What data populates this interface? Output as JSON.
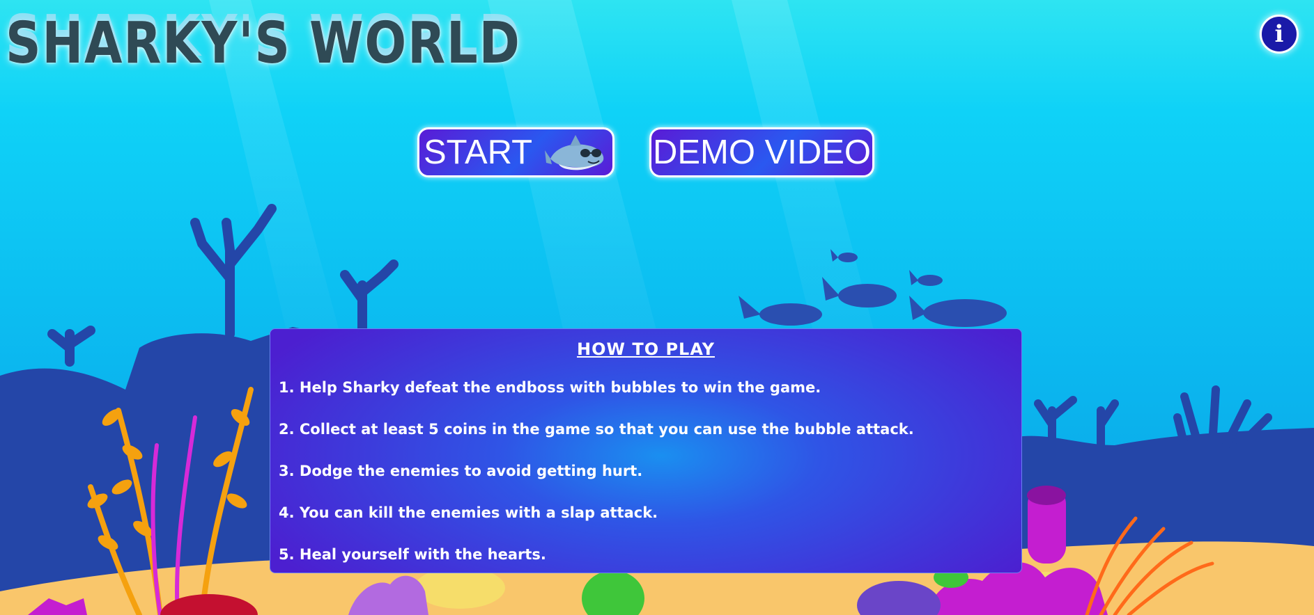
{
  "game_title": "SHARKY'S WORLD",
  "info_button": {
    "label": "i",
    "icon": "info-icon"
  },
  "menu": {
    "start_label": "START",
    "start_icon": "shark-icon",
    "demo_label": "DEMO VIDEO"
  },
  "how_to_play": {
    "title": "HOW TO PLAY",
    "rules": [
      "1. Help Sharky defeat the endboss with bubbles to win the game.",
      "2. Collect at least 5 coins in the game so that you can use the bubble attack.",
      "3. Dodge the enemies to avoid getting hurt.",
      "4. You can kill the enemies with a slap attack.",
      "5. Heal yourself with the hearts."
    ]
  },
  "colors": {
    "sky_top": "#2ee4f2",
    "sky_mid": "#0fc8f5",
    "sky_bottom": "#0aa7e8",
    "silhouette": "#2446a8",
    "sand": "#f9c66b",
    "button_purple": "#5a1bd6",
    "button_blue": "#2a58f0",
    "info_navy": "#1a1aa8"
  }
}
